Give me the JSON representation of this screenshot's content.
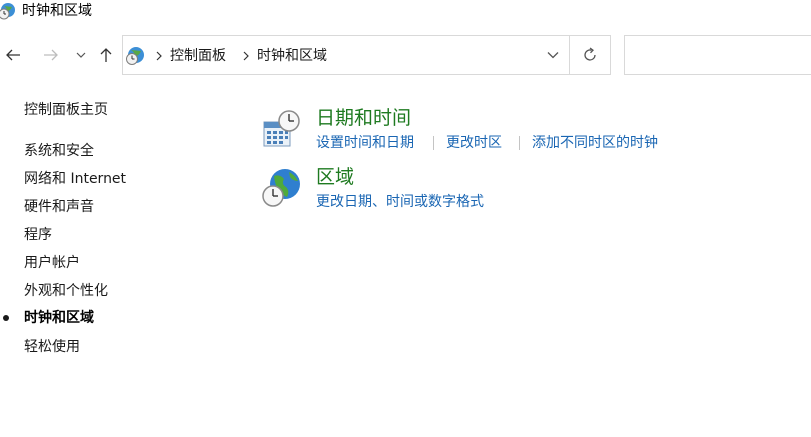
{
  "window": {
    "title": "时钟和区域",
    "title_icon": "clock-globe-icon"
  },
  "nav": {
    "back_icon": "arrow-left-icon",
    "forward_icon": "arrow-right-icon",
    "recent_icon": "chevron-down-icon",
    "up_icon": "arrow-up-icon"
  },
  "address": {
    "breadcrumbs": [
      "控制面板",
      "时钟和区域"
    ],
    "dropdown_icon": "chevron-down-icon",
    "refresh_icon": "refresh-icon"
  },
  "search": {
    "placeholder": ""
  },
  "sidebar": {
    "home": "控制面板主页",
    "items": [
      {
        "label": "系统和安全",
        "active": false
      },
      {
        "label": "网络和 Internet",
        "active": false
      },
      {
        "label": "硬件和声音",
        "active": false
      },
      {
        "label": "程序",
        "active": false
      },
      {
        "label": "用户帐户",
        "active": false
      },
      {
        "label": "外观和个性化",
        "active": false
      },
      {
        "label": "时钟和区域",
        "active": true
      },
      {
        "label": "轻松使用",
        "active": false
      }
    ]
  },
  "categories": [
    {
      "title": "日期和时间",
      "icon": "calendar-clock-icon",
      "links": [
        "设置时间和日期",
        "更改时区",
        "添加不同时区的时钟"
      ]
    },
    {
      "title": "区域",
      "icon": "globe-clock-icon",
      "links": [
        "更改日期、时间或数字格式"
      ]
    }
  ],
  "colors": {
    "category_title": "#1e7a20",
    "link": "#1a66b3",
    "border": "#d9d9d9"
  }
}
